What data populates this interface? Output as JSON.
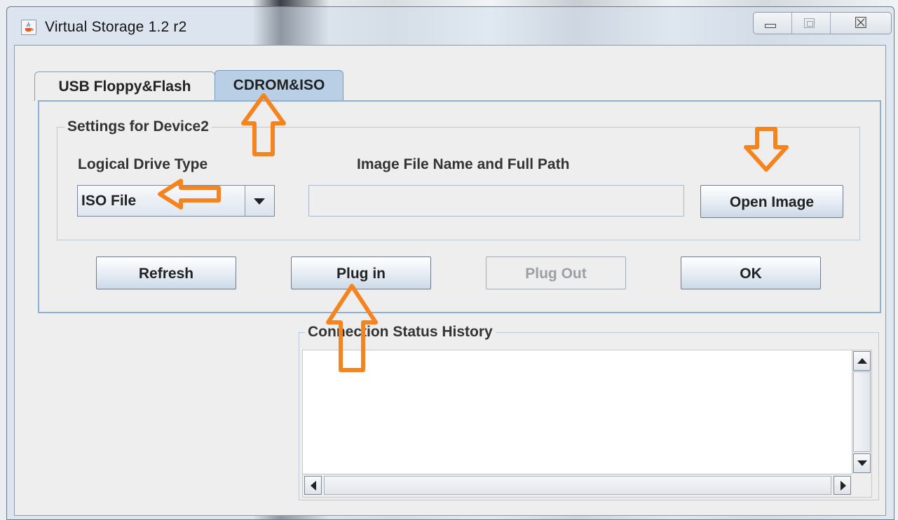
{
  "window": {
    "title": "Virtual Storage 1.2 r2",
    "close_glyph": "☒"
  },
  "tabs": [
    {
      "label": "USB Floppy&Flash",
      "selected": false
    },
    {
      "label": "CDROM&ISO",
      "selected": true
    }
  ],
  "settings": {
    "group_title": "Settings for Device2",
    "drive_type_label": "Logical Drive Type",
    "drive_type_value": "ISO File",
    "image_path_label": "Image File Name and Full Path",
    "image_path_value": "",
    "open_image_button": "Open Image"
  },
  "actions": {
    "refresh": "Refresh",
    "plug_in": "Plug in",
    "plug_out": "Plug Out",
    "ok": "OK"
  },
  "status": {
    "title": "Connection Status History"
  },
  "icons": {
    "app": "java-cup-icon",
    "minimize": "minimize-icon",
    "maximize": "maximize-icon",
    "close": "close-icon",
    "annotation": "orange-arrow-icon"
  },
  "colors": {
    "annotation": "#f5841f",
    "tab_selected": "#b8cfe5",
    "panel_border": "#8fb0d6"
  }
}
